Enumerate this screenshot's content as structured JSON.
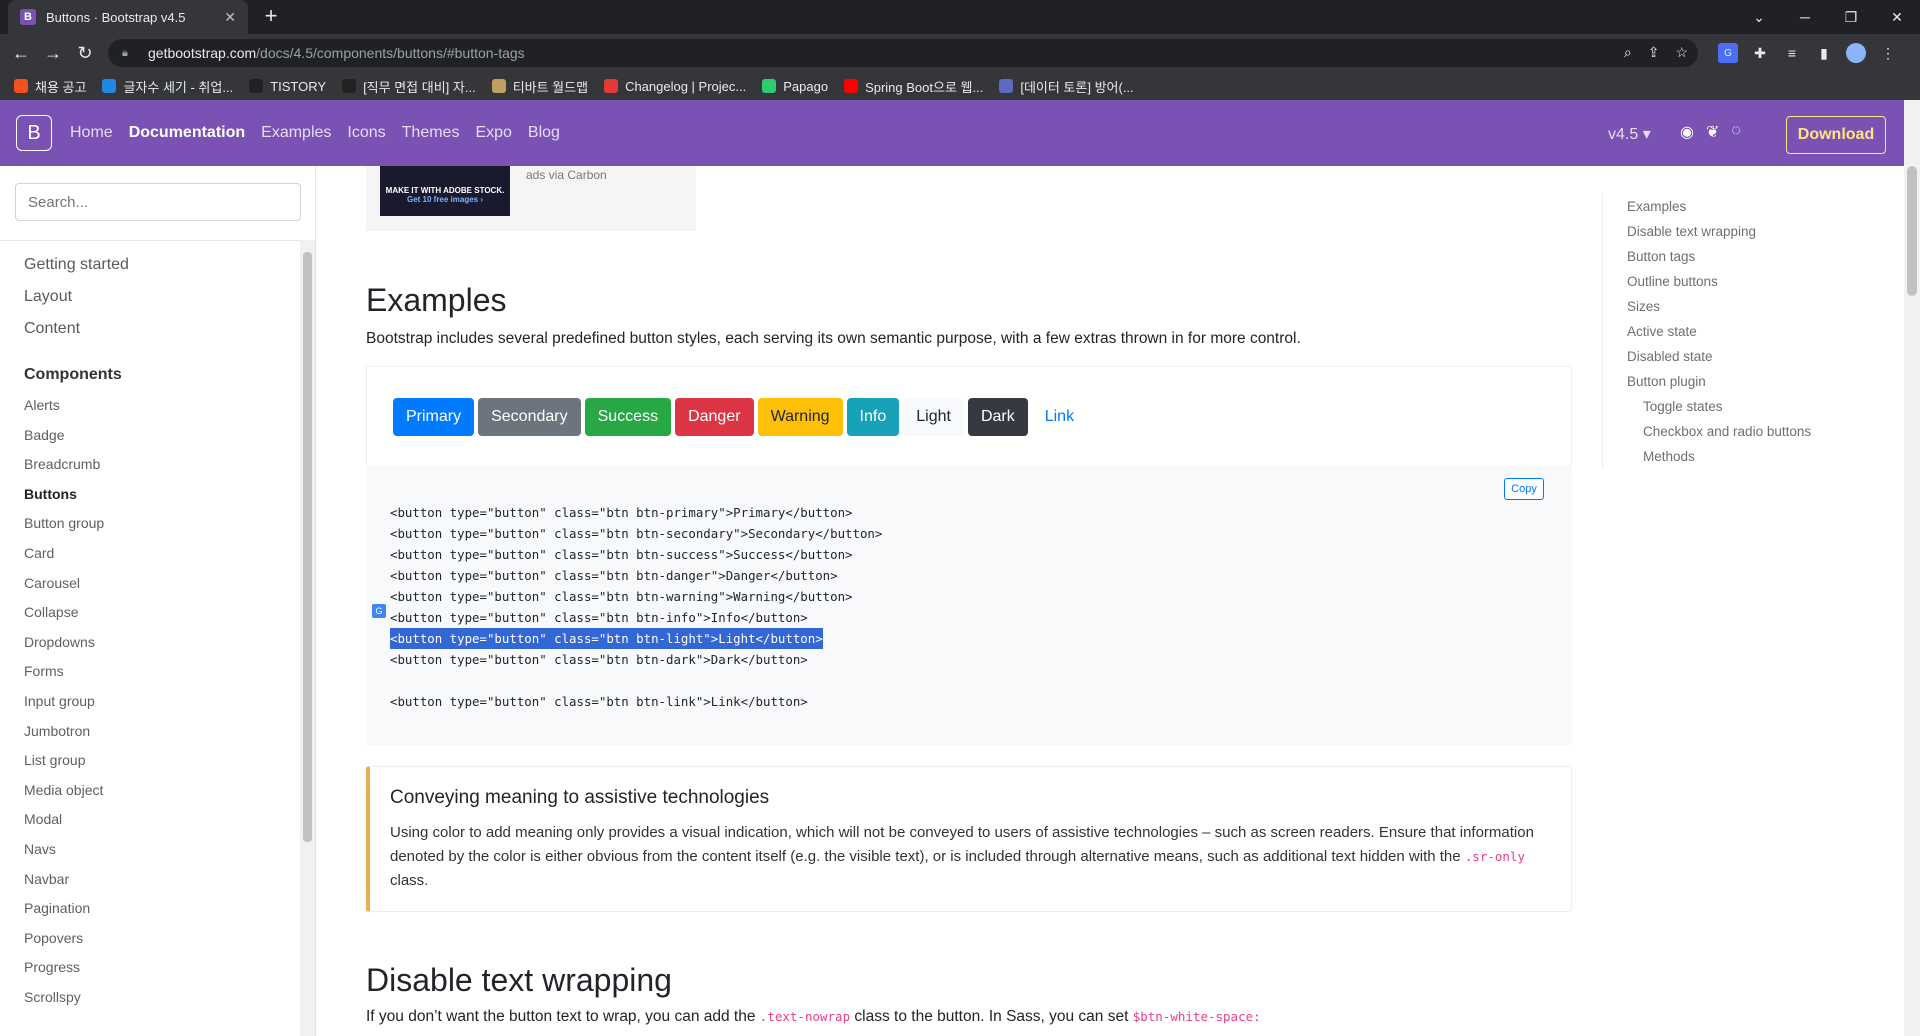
{
  "browser": {
    "tab_title": "Buttons · Bootstrap v4.5",
    "tab_favicon": "B",
    "url_host": "getbootstrap.com",
    "url_path": "/docs/4.5/components/buttons/#button-tags",
    "bookmarks": [
      {
        "label": "채용 공고",
        "color": "#f4511e"
      },
      {
        "label": "글자수 세기 - 취업...",
        "color": "#1e88e5"
      },
      {
        "label": "TISTORY",
        "color": "#222222"
      },
      {
        "label": "[직무 면접 대비] 자...",
        "color": "#222222"
      },
      {
        "label": "티바트 월드맵",
        "color": "#c0a060"
      },
      {
        "label": "Changelog | Projec...",
        "color": "#e53935"
      },
      {
        "label": "Papago",
        "color": "#2ecc71"
      },
      {
        "label": "Spring Boot으로 웹...",
        "color": "#ff0000"
      },
      {
        "label": "[데이터 토론] 방어(...",
        "color": "#5c6bc0"
      }
    ]
  },
  "navbar": {
    "brand": "B",
    "links": [
      "Home",
      "Documentation",
      "Examples",
      "Icons",
      "Themes",
      "Expo",
      "Blog"
    ],
    "version": "v4.5 ▾",
    "download": "Download"
  },
  "sidebar": {
    "search_placeholder": "Search...",
    "groups": [
      "Getting started",
      "Layout",
      "Content"
    ],
    "components_title": "Components",
    "items": [
      "Alerts",
      "Badge",
      "Breadcrumb",
      "Buttons",
      "Button group",
      "Card",
      "Carousel",
      "Collapse",
      "Dropdowns",
      "Forms",
      "Input group",
      "Jumbotron",
      "List group",
      "Media object",
      "Modal",
      "Navs",
      "Navbar",
      "Pagination",
      "Popovers",
      "Progress",
      "Scrollspy"
    ]
  },
  "ad": {
    "title": "MAKE IT WITH ADOBE STOCK.",
    "sub": "Get 10 free images ›",
    "via": "ads via Carbon"
  },
  "examples": {
    "title": "Examples",
    "lead": "Bootstrap includes several predefined button styles, each serving its own semantic purpose, with a few extras thrown in for more control.",
    "buttons": [
      {
        "label": "Primary",
        "bg": "#007bff",
        "fg": "#ffffff"
      },
      {
        "label": "Secondary",
        "bg": "#6c757d",
        "fg": "#ffffff"
      },
      {
        "label": "Success",
        "bg": "#28a745",
        "fg": "#ffffff"
      },
      {
        "label": "Danger",
        "bg": "#dc3545",
        "fg": "#ffffff"
      },
      {
        "label": "Warning",
        "bg": "#ffc107",
        "fg": "#212529"
      },
      {
        "label": "Info",
        "bg": "#17a2b8",
        "fg": "#ffffff"
      },
      {
        "label": "Light",
        "bg": "#f8f9fa",
        "fg": "#212529"
      },
      {
        "label": "Dark",
        "bg": "#343a40",
        "fg": "#ffffff"
      },
      {
        "label": "Link",
        "bg": "transparent",
        "fg": "#007bff"
      }
    ],
    "copy": "Copy",
    "code_lines": [
      "<button type=\"button\" class=\"btn btn-primary\">Primary</button>",
      "<button type=\"button\" class=\"btn btn-secondary\">Secondary</button>",
      "<button type=\"button\" class=\"btn btn-success\">Success</button>",
      "<button type=\"button\" class=\"btn btn-danger\">Danger</button>",
      "<button type=\"button\" class=\"btn btn-warning\">Warning</button>",
      "<button type=\"button\" class=\"btn btn-info\">Info</button>",
      "<button type=\"button\" class=\"btn btn-light\">Light</button>",
      "<button type=\"button\" class=\"btn btn-dark\">Dark</button>",
      "",
      "<button type=\"button\" class=\"btn btn-link\">Link</button>"
    ]
  },
  "callout": {
    "title": "Conveying meaning to assistive technologies",
    "text_before": "Using color to add meaning only provides a visual indication, which will not be conveyed to users of assistive technologies – such as screen readers. Ensure that information denoted by the color is either obvious from the content itself (e.g. the visible text), or is included through alternative means, such as additional text hidden with the ",
    "code": ".sr-only",
    "text_after": " class."
  },
  "disable_wrap": {
    "title": "Disable text wrapping",
    "text_before": "If you don’t want the button text to wrap, you can add the ",
    "code1": ".text-nowrap",
    "text_mid": " class to the button. In Sass, you can set ",
    "code2": "$btn-white-space:"
  },
  "toc": [
    {
      "label": "Examples",
      "sub": false
    },
    {
      "label": "Disable text wrapping",
      "sub": false
    },
    {
      "label": "Button tags",
      "sub": false
    },
    {
      "label": "Outline buttons",
      "sub": false
    },
    {
      "label": "Sizes",
      "sub": false
    },
    {
      "label": "Active state",
      "sub": false
    },
    {
      "label": "Disabled state",
      "sub": false
    },
    {
      "label": "Button plugin",
      "sub": false
    },
    {
      "label": "Toggle states",
      "sub": true
    },
    {
      "label": "Checkbox and radio buttons",
      "sub": true
    },
    {
      "label": "Methods",
      "sub": true
    }
  ]
}
